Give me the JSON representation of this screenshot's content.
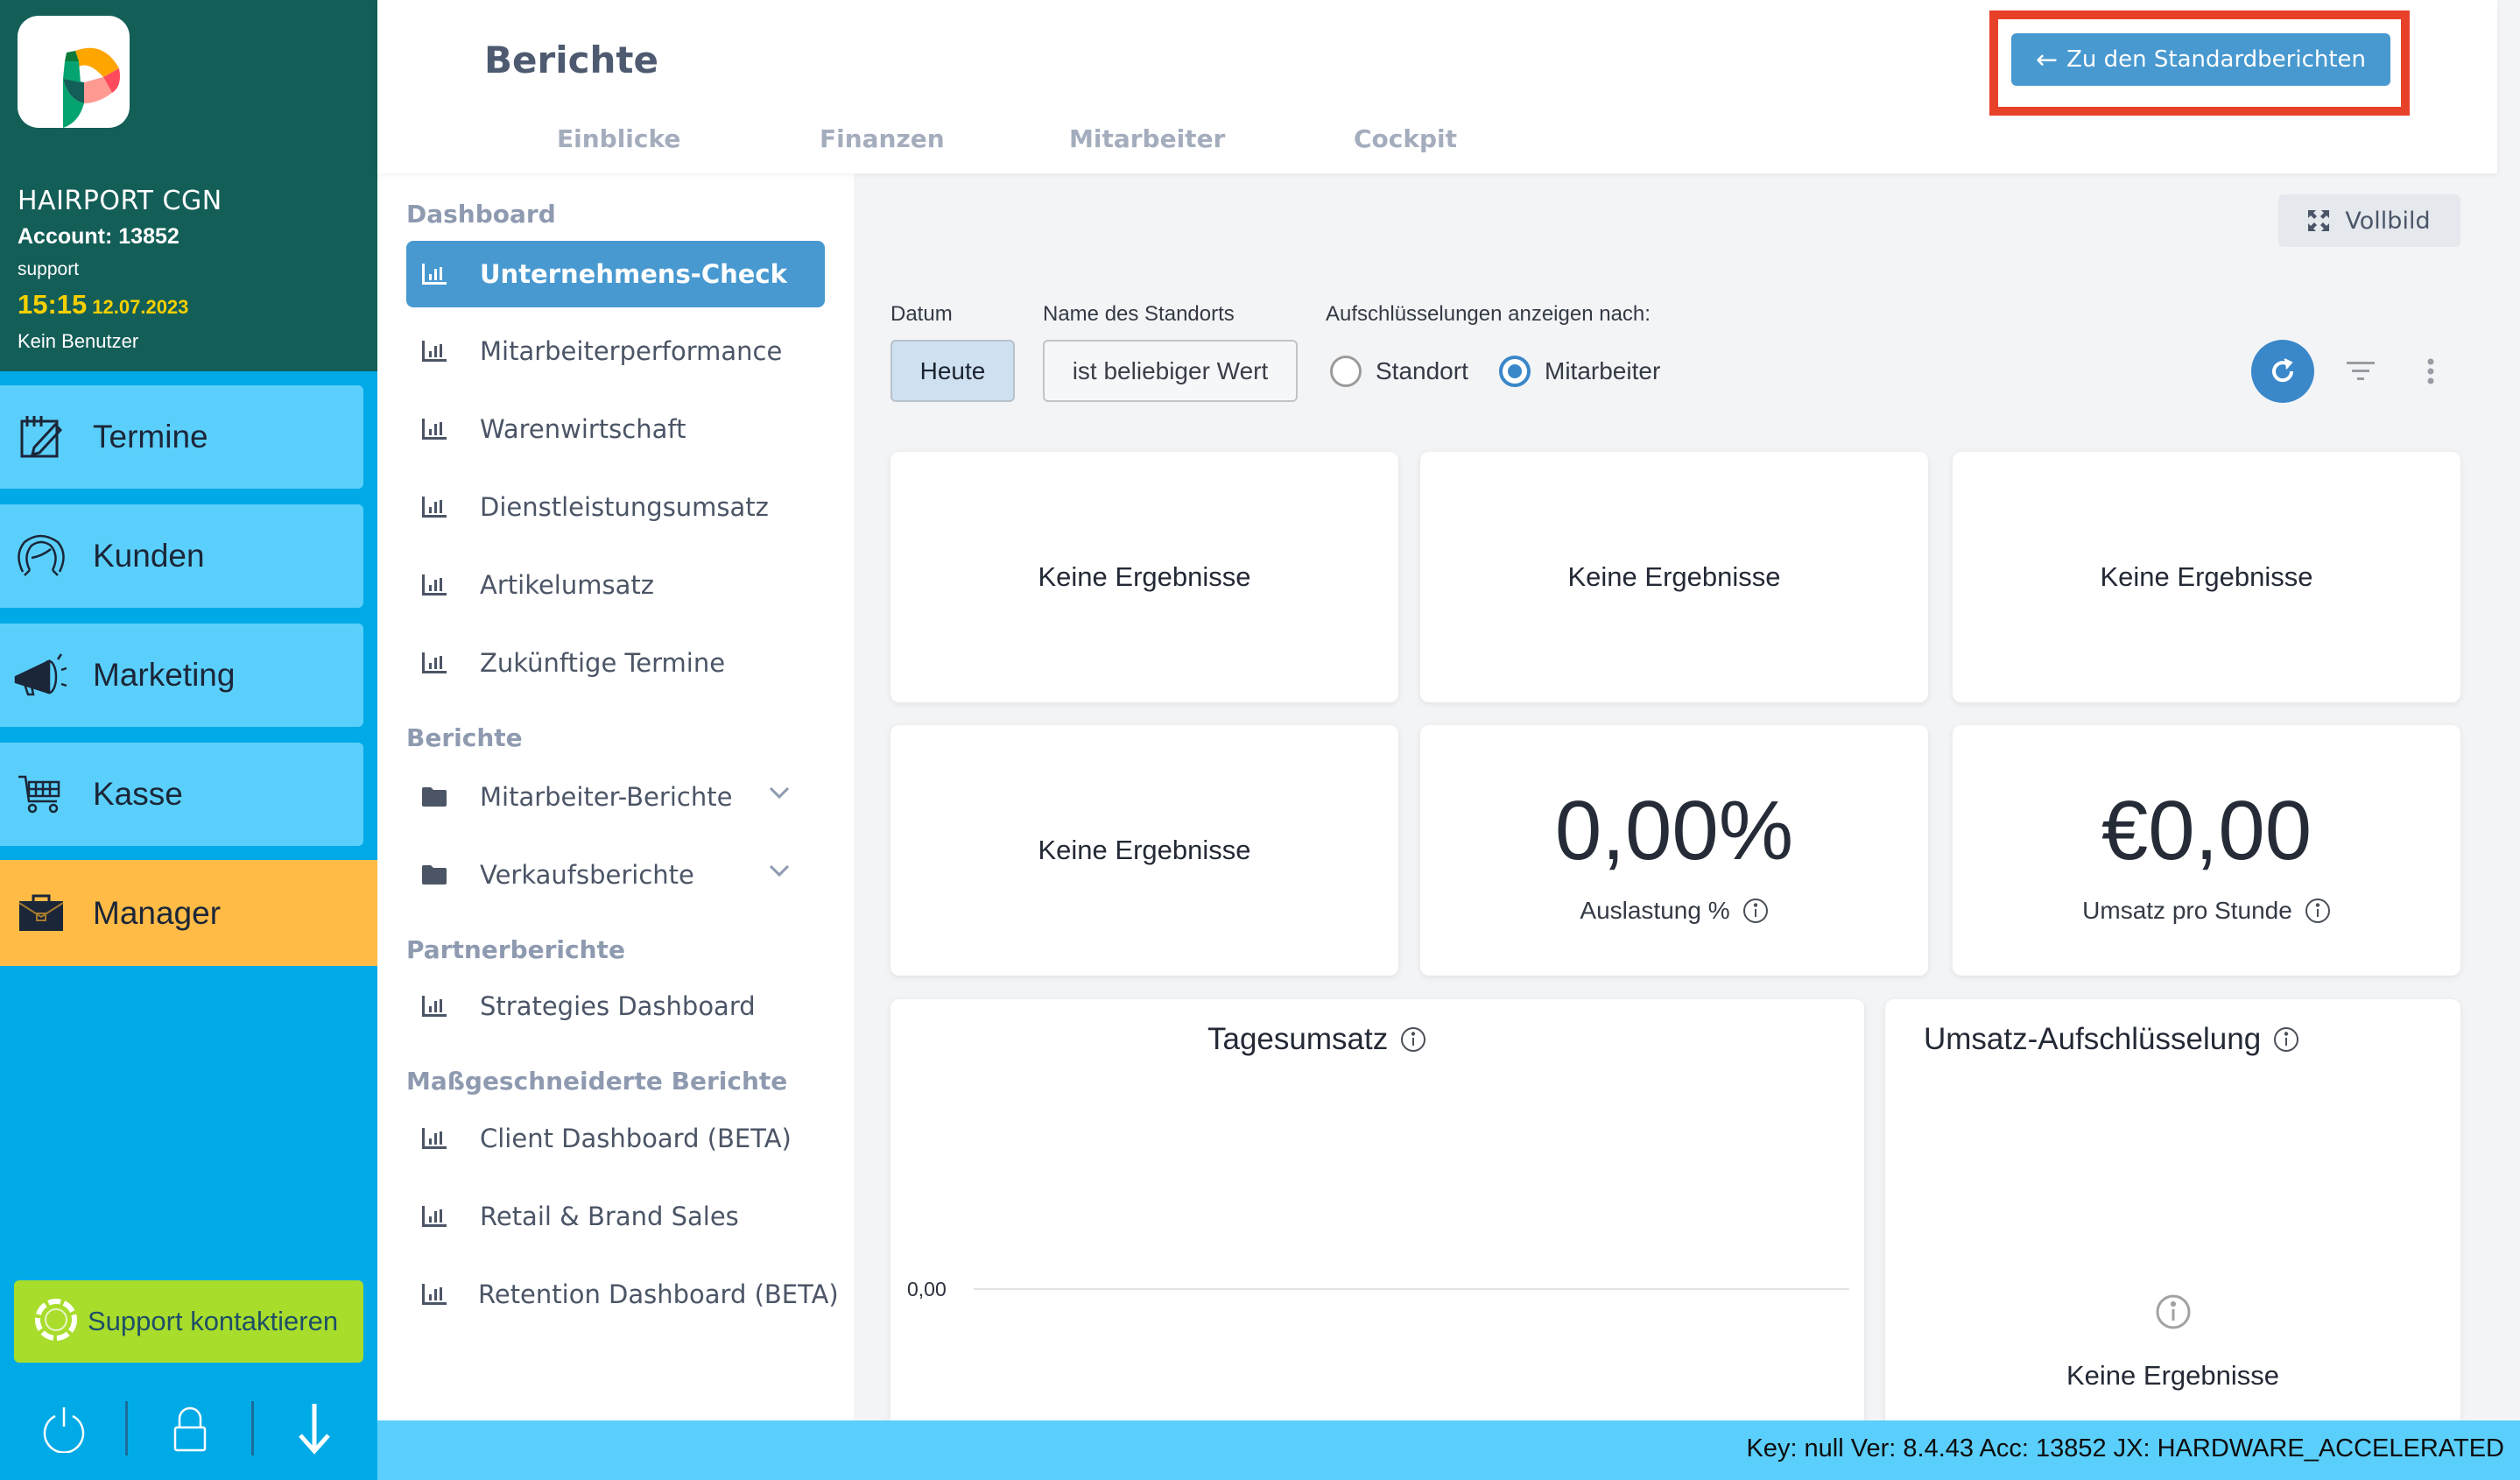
{
  "account": {
    "salon_name": "HAIRPORT CGN",
    "account_label": "Account: 13852",
    "user": "support",
    "time": "15:15",
    "date": "12.07.2023",
    "benutzer": "Kein Benutzer"
  },
  "nav": {
    "items": [
      {
        "label": "Termine",
        "icon": "calendar-edit-icon"
      },
      {
        "label": "Kunden",
        "icon": "customer-face-icon"
      },
      {
        "label": "Marketing",
        "icon": "megaphone-icon"
      },
      {
        "label": "Kasse",
        "icon": "shopping-cart-icon"
      },
      {
        "label": "Manager",
        "icon": "briefcase-icon"
      }
    ],
    "support_label": "Support kontaktieren",
    "bottom_icons": [
      "power-icon",
      "lock-icon",
      "arrow-down-icon"
    ]
  },
  "header": {
    "title": "Berichte",
    "tabs": [
      "Einblicke",
      "Finanzen",
      "Mitarbeiter",
      "Cockpit"
    ],
    "std_reports_button": "Zu den Standardberichten",
    "std_reports_arrow": "←"
  },
  "report_nav": {
    "sections": [
      {
        "title": "Dashboard",
        "items": [
          {
            "label": "Unternehmens-Check",
            "active": true
          },
          {
            "label": "Mitarbeiterperformance"
          },
          {
            "label": "Warenwirtschaft"
          },
          {
            "label": "Dienstleistungsumsatz"
          },
          {
            "label": "Artikelumsatz"
          },
          {
            "label": "Zukünftige Termine"
          }
        ]
      },
      {
        "title": "Berichte",
        "items": [
          {
            "label": "Mitarbeiter-Berichte",
            "folder": true
          },
          {
            "label": "Verkaufsberichte",
            "folder": true
          }
        ]
      },
      {
        "title": "Partnerberichte",
        "items": [
          {
            "label": "Strategies Dashboard"
          }
        ]
      },
      {
        "title": "Maßgeschneiderte Berichte",
        "items": [
          {
            "label": "Client Dashboard (BETA)"
          },
          {
            "label": "Retail & Brand Sales"
          },
          {
            "label": "Retention Dashboard (BETA)"
          }
        ]
      }
    ]
  },
  "toolbar": {
    "vollbild": "Vollbild"
  },
  "filters": {
    "date_label": "Datum",
    "date_value": "Heute",
    "location_label": "Name des Standorts",
    "location_value": "ist beliebiger Wert",
    "breakdown_label": "Aufschlüsselungen anzeigen nach:",
    "breakdown_options": [
      "Standort",
      "Mitarbeiter"
    ],
    "breakdown_selected": "Mitarbeiter"
  },
  "tiles": {
    "empty_text": "Keine Ergebnisse",
    "utilization": {
      "value": "0,00%",
      "label": "Auslastung %"
    },
    "revenue_per_hour": {
      "value": "€0,00",
      "label": "Umsatz pro Stunde"
    },
    "daily_revenue": {
      "title": "Tagesumsatz"
    },
    "revenue_breakdown": {
      "title": "Umsatz-Aufschlüsselung",
      "empty_text": "Keine Ergebnisse"
    }
  },
  "chart_data": {
    "type": "line",
    "title": "Tagesumsatz",
    "xlabel": "",
    "ylabel": "",
    "y_ticks": [
      "0,00"
    ],
    "ylim": [
      0,
      0
    ],
    "series": [],
    "grid": true
  },
  "status_bar": {
    "text": "Key: null Ver: 8.4.43 Acc: 13852  JX: HARDWARE_ACCELERATED"
  },
  "colors": {
    "account_panel": "#145e58",
    "sidebar": "#00aae6",
    "nav_item": "#5bcffb",
    "manager_active": "#ffbb46",
    "support": "#a8dd2c",
    "primary": "#4899d0",
    "highlight": "#e8412a",
    "clock": "#f5d000"
  }
}
